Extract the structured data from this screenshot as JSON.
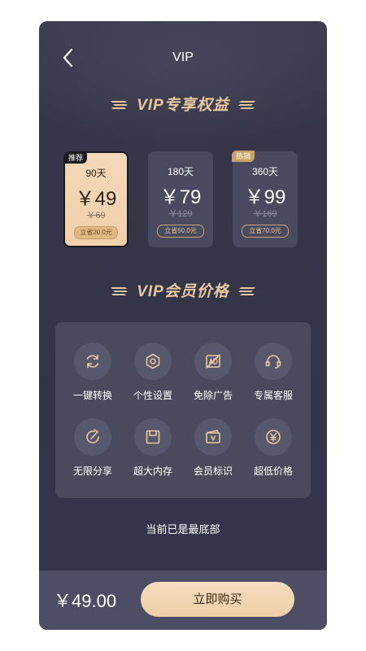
{
  "nav": {
    "title": "VIP"
  },
  "sections": {
    "benefits_title": "VIP专享权益",
    "price_title": "VIP会员价格"
  },
  "plans": [
    {
      "badge": "推荐",
      "days": "90天",
      "price": "￥49",
      "original": "￥69",
      "save": "立省20.0元",
      "selected": true
    },
    {
      "badge": "",
      "days": "180天",
      "price": "￥79",
      "original": "￥129",
      "save": "立省50.0元",
      "selected": false
    },
    {
      "badge": "热销",
      "days": "360天",
      "price": "￥99",
      "original": "￥169",
      "save": "立省70.0元",
      "selected": false
    }
  ],
  "features": [
    {
      "label": "一键转换",
      "icon": "refresh-icon"
    },
    {
      "label": "个性设置",
      "icon": "settings-hex-icon"
    },
    {
      "label": "免除广告",
      "icon": "no-ads-icon"
    },
    {
      "label": "专属客服",
      "icon": "headset-icon"
    },
    {
      "label": "无限分享",
      "icon": "share-arrow-icon"
    },
    {
      "label": "超大内存",
      "icon": "storage-icon"
    },
    {
      "label": "会员标识",
      "icon": "vip-badge-icon"
    },
    {
      "label": "超低价格",
      "icon": "yen-coin-icon"
    }
  ],
  "footer_note": "当前已是最底部",
  "bottom": {
    "total": "￥49.00",
    "buy_label": "立即购买"
  },
  "colors": {
    "accent_gold": "#e9c8a0",
    "background": "#363648",
    "selected_card": "#f3d5b3"
  }
}
